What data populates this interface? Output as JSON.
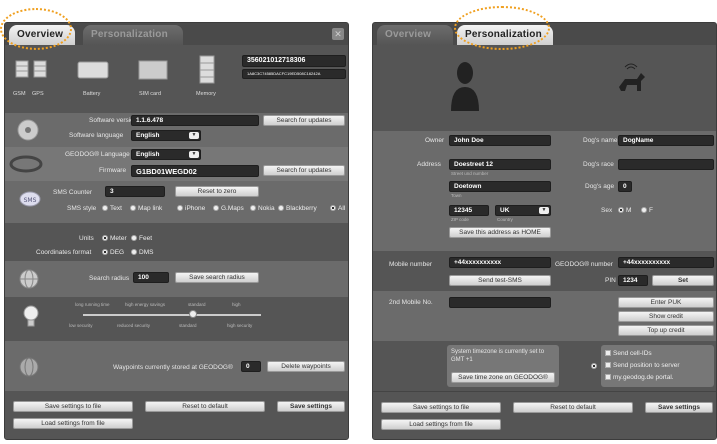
{
  "left": {
    "tabs": [
      "Overview",
      "Personalization"
    ],
    "devices": [
      "GSM",
      "GPS",
      "Battery",
      "SIM card",
      "Memory"
    ],
    "imei": "356021012718306",
    "device_id": "1A8C3C74585DACFC19ED508C16242A",
    "software_version_label": "Software version",
    "software_version": "1.1.6.478",
    "software_language_label": "Software language",
    "software_language": "English",
    "search_updates": "Search for updates",
    "geodog_language_label": "GEODOG® Language",
    "geodog_language": "English",
    "firmware_label": "Firmware",
    "firmware": "G1BD01WEGD02",
    "search_updates2": "Search for updates",
    "sms_counter_label": "SMS Counter",
    "sms_counter": "3",
    "reset_zero": "Reset to zero",
    "sms_style_label": "SMS style",
    "sms_styles": [
      {
        "label": "Text",
        "on": false
      },
      {
        "label": "Map link",
        "on": false
      },
      {
        "label": "iPhone",
        "on": false
      },
      {
        "label": "G.Maps",
        "on": false
      },
      {
        "label": "Nokia",
        "on": false
      },
      {
        "label": "Blackberry",
        "on": false
      },
      {
        "label": "All",
        "on": true
      }
    ],
    "units_label": "Units",
    "units": [
      {
        "label": "Meter",
        "on": true
      },
      {
        "label": "Feet",
        "on": false
      }
    ],
    "coord_label": "Coordinates format",
    "coords": [
      {
        "label": "DEG",
        "on": true
      },
      {
        "label": "DMS",
        "on": false
      }
    ],
    "search_radius_label": "Search radius",
    "search_radius": "100",
    "save_radius": "Save search radius",
    "slider_top": [
      "long running time",
      "high energy savings",
      "standard",
      "high"
    ],
    "slider_bottom": [
      "low security",
      "reduced security",
      "standard",
      "high security"
    ],
    "slider_level": 0.62,
    "waypoints_label": "Waypoints currently stored at GEODOG®",
    "waypoints": "0",
    "delete_waypoints": "Delete waypoints",
    "save_file": "Save settings to file",
    "reset_default": "Reset to default",
    "save_settings": "Save settings",
    "load_file": "Load settings from file"
  },
  "right": {
    "tabs": [
      "Overview",
      "Personalization"
    ],
    "owner_label": "Owner",
    "owner": "John Doe",
    "dog_name_label": "Dog's name",
    "dog_name": "DogName",
    "address_label": "Address",
    "street": "Doestreet 12",
    "street_sub": "Street und number",
    "dog_race_label": "Dog's race",
    "dog_race": "",
    "town": "Doetown",
    "town_sub": "Town",
    "dog_age_label": "Dog's age",
    "dog_age": "0",
    "zip": "12345",
    "zip_sub": "ZIP code",
    "country": "UK",
    "country_sub": "Country",
    "sex_label": "Sex",
    "sex": [
      {
        "label": "M",
        "on": true
      },
      {
        "label": "F",
        "on": false
      }
    ],
    "save_home": "Save this address as HOME",
    "mobile_label": "Mobile number",
    "mobile": "+44xxxxxxxxxx",
    "geodog_number_label": "GEODOG® number",
    "geodog_number": "+44xxxxxxxxxx",
    "send_test_sms": "Send test-SMS",
    "pin_label": "PIN",
    "pin": "1234",
    "set": "Set",
    "second_mobile_label": "2nd Mobile No.",
    "second_mobile": "",
    "enter_puk": "Enter PUK",
    "show_credit": "Show credit",
    "top_up": "Top up credit",
    "timezone_text": "System timezone is currently set to GMT +1",
    "save_timezone": "Save time zone on GEODOG®",
    "checks": [
      "Send cell-IDs",
      "Send position to server",
      "my.geodog.de portal."
    ],
    "save_file": "Save settings to file",
    "reset_default": "Reset to default",
    "save_settings": "Save settings",
    "load_file": "Load settings from file"
  }
}
